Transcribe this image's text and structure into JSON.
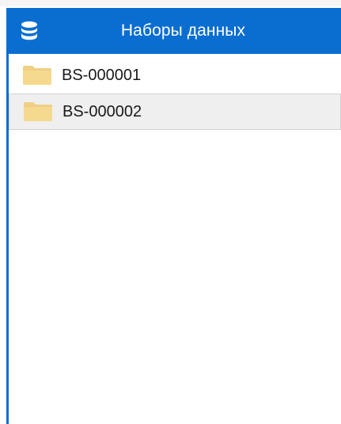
{
  "header": {
    "title": "Наборы данных",
    "icon": "database-icon"
  },
  "datasets": [
    {
      "label": "BS-000001",
      "icon": "folder-icon",
      "selected": false
    },
    {
      "label": "BS-000002",
      "icon": "folder-icon",
      "selected": true
    }
  ],
  "colors": {
    "header_bg": "#0a6ed1",
    "folder": "#f0cf83",
    "selected_bg": "#efefef"
  }
}
